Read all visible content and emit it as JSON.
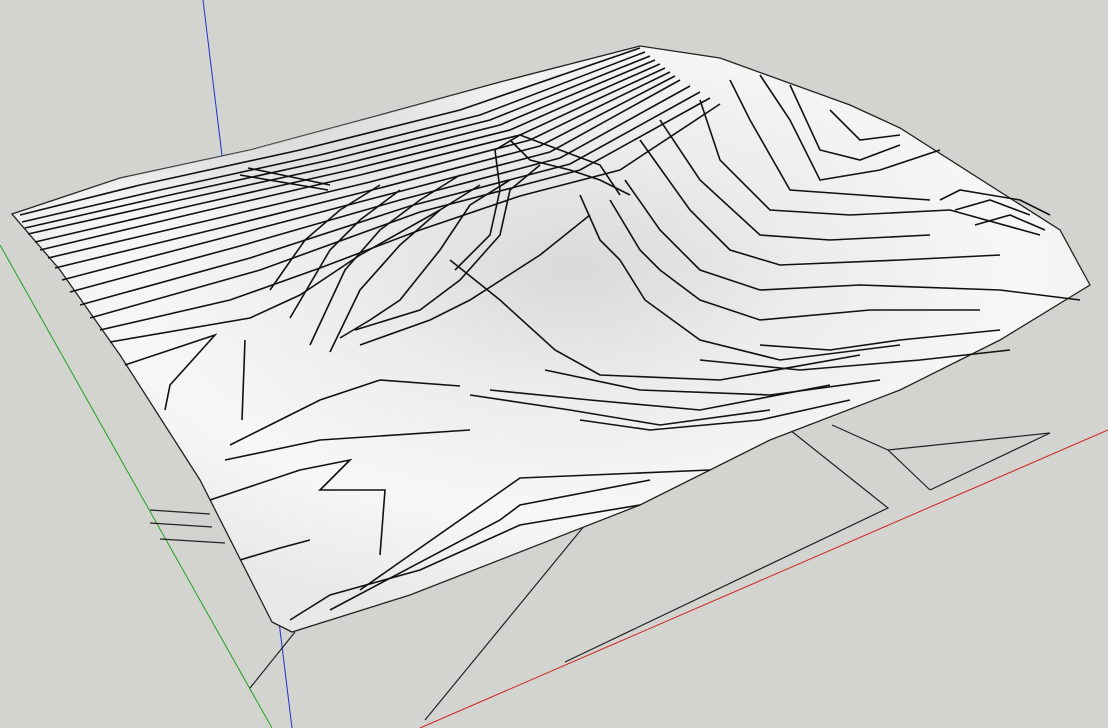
{
  "viewport": {
    "background": "#d3d4cf",
    "terrain_fill": "#f1f1f1",
    "contour_color": "#111111"
  },
  "axes": {
    "red": "#d02020",
    "green": "#21a021",
    "blue": "#1f2fd0"
  }
}
